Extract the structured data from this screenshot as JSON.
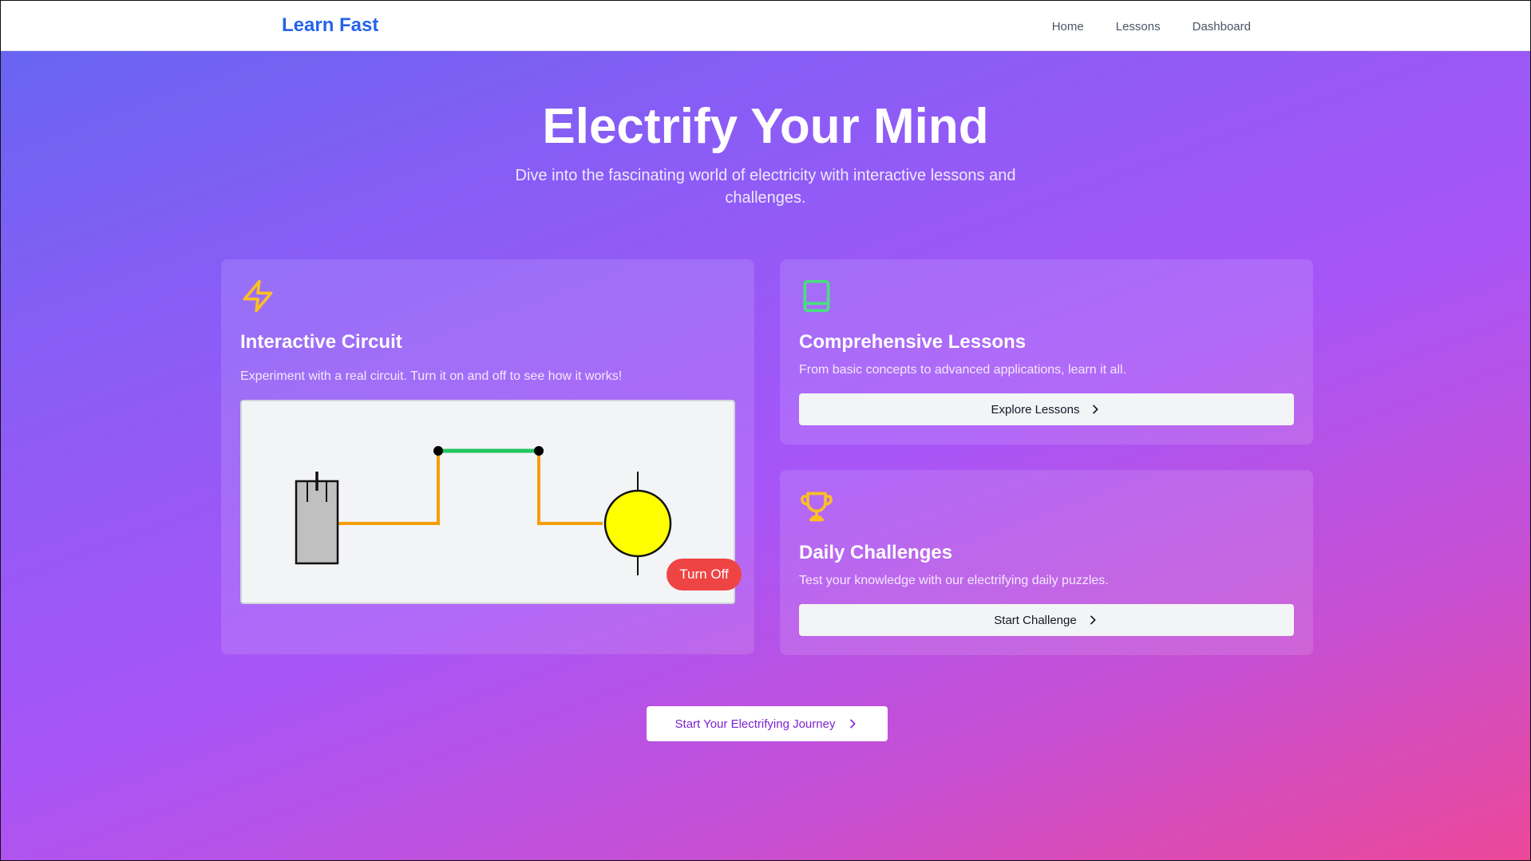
{
  "nav": {
    "brand": "Learn Fast",
    "links": [
      "Home",
      "Lessons",
      "Dashboard"
    ]
  },
  "hero": {
    "title": "Electrify Your Mind",
    "subtitle": "Dive into the fascinating world of electricity with interactive lessons and challenges."
  },
  "cards": {
    "circuit": {
      "icon": "lightning-icon",
      "title": "Interactive Circuit",
      "description": "Experiment with a real circuit. Turn it on and off to see how it works!",
      "toggle_label": "Turn Off",
      "switch_state": "on"
    },
    "lessons": {
      "icon": "book-icon",
      "title": "Comprehensive Lessons",
      "description": "From basic concepts to advanced applications, learn it all.",
      "button_label": "Explore Lessons"
    },
    "challenges": {
      "icon": "trophy-icon",
      "title": "Daily Challenges",
      "description": "Test your knowledge with our electrifying daily puzzles.",
      "button_label": "Start Challenge"
    }
  },
  "cta": {
    "label": "Start Your Electrifying Journey"
  },
  "colors": {
    "brand": "#2563eb",
    "wire": "#f59e0b",
    "switch_closed": "#22c55e",
    "bulb_on": "#ffff00",
    "turn_off_button": "#ef4444",
    "lightning_icon": "#fbbf24",
    "book_icon": "#4ade80",
    "trophy_icon": "#fbbf24"
  }
}
